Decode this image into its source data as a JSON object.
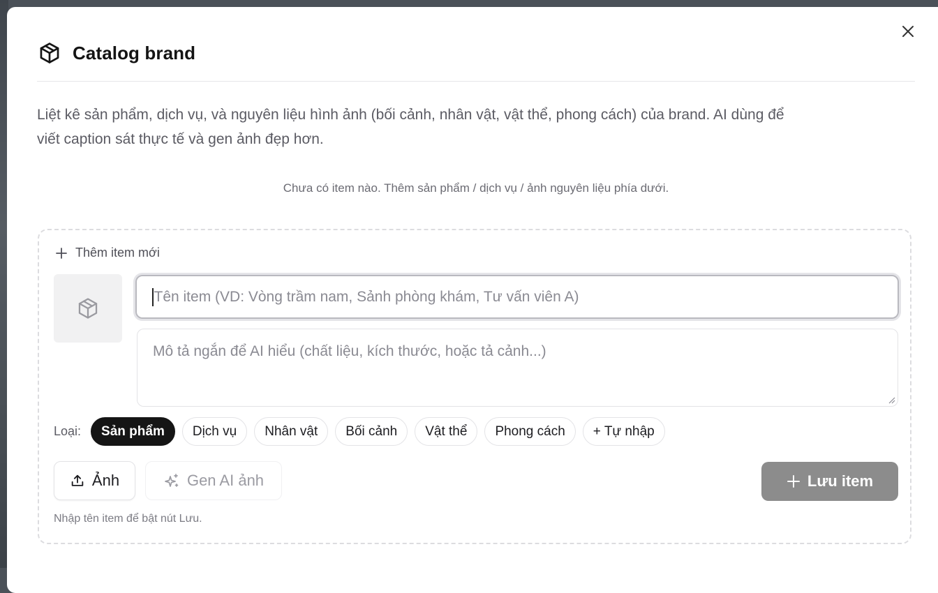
{
  "modal": {
    "title": "Catalog brand",
    "title_icon": "package-icon",
    "close_icon": "close-icon",
    "description_line1": "Liệt kê sản phẩm, dịch vụ, và nguyên liệu hình ảnh (bối cảnh, nhân vật, vật thể, phong cách) của brand. AI dùng để",
    "description_line2": "viết caption sát thực tế và gen ảnh đẹp hơn.",
    "empty_note": "Chưa có item nào. Thêm sản phẩm / dịch vụ / ảnh nguyên liệu phía dưới."
  },
  "form": {
    "header_label": "Thêm item mới",
    "name_placeholder": "Tên item (VD: Vòng trầm nam, Sảnh phòng khám, Tư vấn viên A)",
    "name_value": "",
    "desc_placeholder": "Mô tả ngắn để AI hiểu (chất liệu, kích thước, hoặc tả cảnh...)",
    "desc_value": "",
    "type_label": "Loại:",
    "types": [
      {
        "label": "Sản phẩm",
        "selected": true
      },
      {
        "label": "Dịch vụ",
        "selected": false
      },
      {
        "label": "Nhân vật",
        "selected": false
      },
      {
        "label": "Bối cảnh",
        "selected": false
      },
      {
        "label": "Vật thể",
        "selected": false
      },
      {
        "label": "Phong cách",
        "selected": false
      },
      {
        "label": "+ Tự nhập",
        "selected": false
      }
    ],
    "upload_label": "Ảnh",
    "gen_label": "Gen AI ảnh",
    "save_label": "Lưu item",
    "hint": "Nhập tên item để bật nút Lưu."
  },
  "colors": {
    "active_chip": "#151515",
    "save_disabled": "#8c8c8c",
    "backdrop": "#4b5158"
  }
}
